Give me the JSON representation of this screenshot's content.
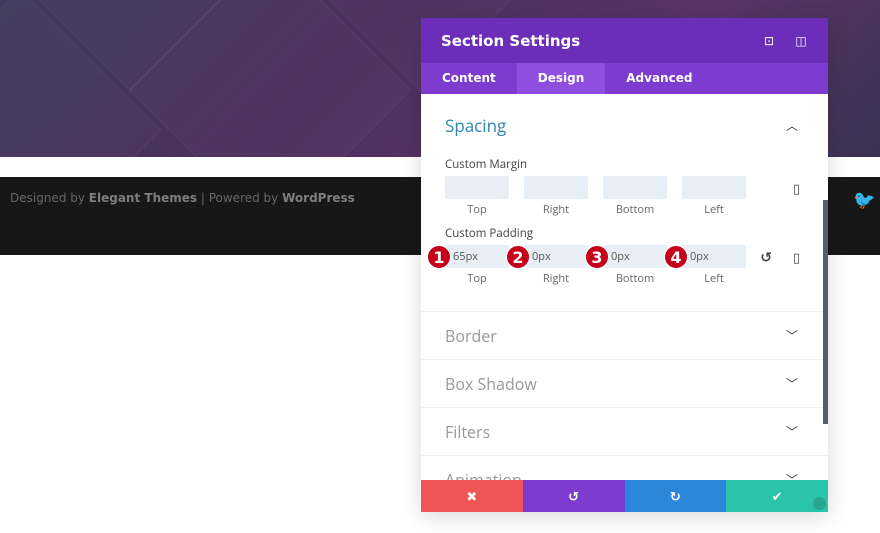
{
  "footer": {
    "designed_by": "Designed by",
    "elegant": "Elegant Themes",
    "sep": " | Powered by ",
    "wordpress": "WordPress"
  },
  "panel": {
    "title": "Section Settings",
    "tabs": [
      {
        "label": "Content"
      },
      {
        "label": "Design"
      },
      {
        "label": "Advanced"
      }
    ],
    "active_tab": "Design",
    "spacing": {
      "title": "Spacing",
      "margin_label": "Custom Margin",
      "padding_label": "Custom Padding",
      "sides": [
        "Top",
        "Right",
        "Bottom",
        "Left"
      ],
      "margin_values": [
        "",
        "",
        "",
        ""
      ],
      "padding_values": [
        "65px",
        "0px",
        "0px",
        "0px"
      ],
      "badges": [
        "1",
        "2",
        "3",
        "4"
      ]
    },
    "groups": [
      {
        "label": "Border"
      },
      {
        "label": "Box Shadow"
      },
      {
        "label": "Filters"
      },
      {
        "label": "Animation"
      }
    ]
  },
  "colors": {
    "header": "#6c2eb9",
    "tabs": "#7d3bcf",
    "cancel": "#ef5555",
    "undo": "#7e3bd0",
    "redo": "#2b87da",
    "save": "#29c4a9",
    "badge": "#c4001a"
  }
}
